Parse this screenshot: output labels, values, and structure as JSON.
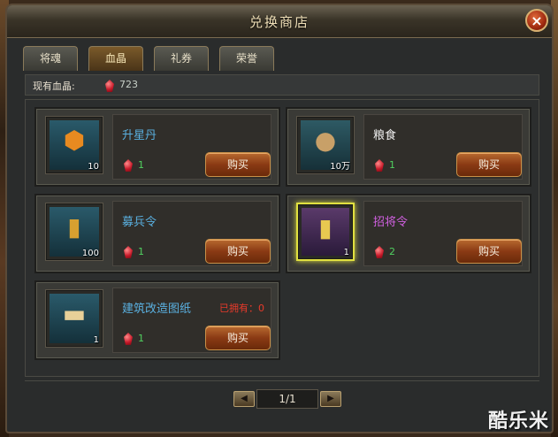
{
  "window": {
    "title": "兑换商店",
    "close_icon": "close-icon"
  },
  "tabs": [
    {
      "label": "将魂",
      "active": false
    },
    {
      "label": "血晶",
      "active": true
    },
    {
      "label": "礼券",
      "active": false
    },
    {
      "label": "荣誉",
      "active": false
    }
  ],
  "currency": {
    "label": "现有血晶:",
    "icon": "blood-crystal-icon",
    "value": "723"
  },
  "items": [
    {
      "name": "升星丹",
      "name_color": "#5ab0e0",
      "quantity": "10",
      "price": "1",
      "icon": "star-pill-icon",
      "owned_text": "",
      "buy_label": "购买"
    },
    {
      "name": "粮食",
      "name_color": "#f0f0f0",
      "quantity": "10万",
      "price": "1",
      "icon": "grain-sack-icon",
      "owned_text": "",
      "buy_label": "购买"
    },
    {
      "name": "募兵令",
      "name_color": "#5ab0e0",
      "quantity": "100",
      "price": "1",
      "icon": "recruit-token-icon",
      "owned_text": "",
      "buy_label": "购买"
    },
    {
      "name": "招将令",
      "name_color": "#d060e0",
      "quantity": "1",
      "price": "2",
      "icon": "general-token-icon",
      "owned_text": "",
      "buy_label": "购买"
    },
    {
      "name": "建筑改造图纸",
      "name_color": "#5ab0e0",
      "quantity": "1",
      "price": "1",
      "icon": "blueprint-scroll-icon",
      "owned_text": "已拥有：0",
      "buy_label": "购买"
    }
  ],
  "pagination": {
    "current": "1/1",
    "prev_icon": "prev-arrow-icon",
    "next_icon": "next-arrow-icon"
  },
  "watermark": "酷乐米"
}
